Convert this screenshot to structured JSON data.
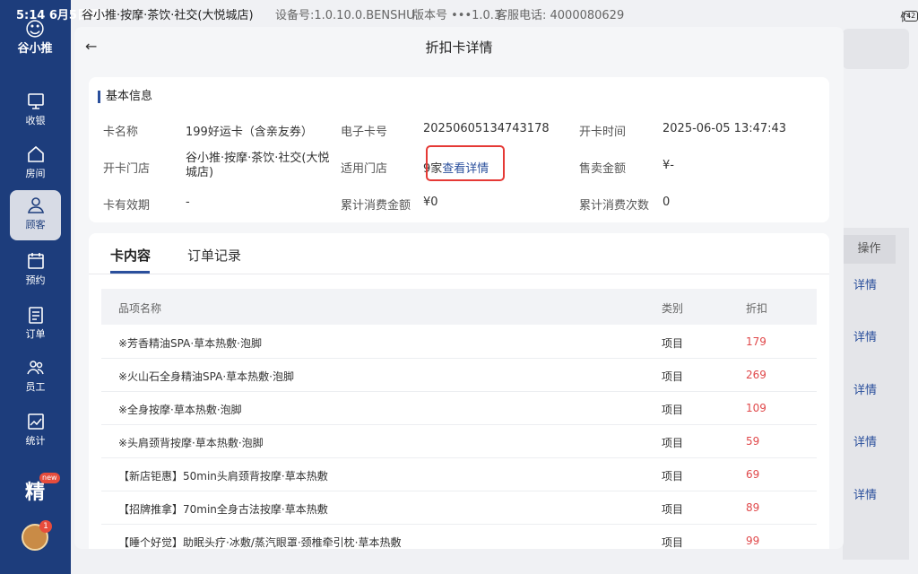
{
  "status_bar": {
    "time": "5:14  6月5日周四",
    "store": "谷小推·按摩·茶饮·社交(大悦城店)",
    "device": "设备号:1.0.10.0.BENSHU",
    "version": "版本号 •••1.0.3",
    "phone": "客服电话:  4000080629",
    "battery": "42"
  },
  "sidebar": {
    "logo_text": "谷小推",
    "items": [
      {
        "label": "收银",
        "icon": "cashier-icon"
      },
      {
        "label": "房间",
        "icon": "home-icon"
      },
      {
        "label": "顾客",
        "icon": "user-icon"
      },
      {
        "label": "预约",
        "icon": "calendar-icon"
      },
      {
        "label": "订单",
        "icon": "order-icon"
      },
      {
        "label": "员工",
        "icon": "staff-icon"
      },
      {
        "label": "统计",
        "icon": "chart-icon"
      }
    ],
    "active_index": 2,
    "promo_badge": "new",
    "promo_icon": "精",
    "avatar_badge": "1"
  },
  "background_page": {
    "column_header": "操作",
    "links": [
      "详情",
      "详情",
      "详情",
      "详情",
      "详情"
    ]
  },
  "modal": {
    "title": "折扣卡详情",
    "basic_info_title": "基本信息",
    "fields": {
      "card_name_label": "卡名称",
      "card_name": "199好运卡（含亲友券）",
      "card_no_label": "电子卡号",
      "card_no": "20250605134743178",
      "open_time_label": "开卡时间",
      "open_time": "2025-06-05 13:47:43",
      "open_store_label": "开卡门店",
      "open_store": "谷小推·按摩·茶饮·社交(大悦城店)",
      "applicable_store_label": "适用门店",
      "applicable_store_count": "9家",
      "view_detail": "查看详情",
      "sale_amount_label": "售卖金额",
      "sale_amount": "¥-",
      "validity_label": "卡有效期",
      "validity": "-",
      "total_spent_label": "累计消费金额",
      "total_spent": "¥0",
      "total_count_label": "累计消费次数",
      "total_count": "0"
    },
    "tabs": [
      {
        "label": "卡内容"
      },
      {
        "label": "订单记录"
      }
    ],
    "table": {
      "headers": [
        "品项名称",
        "类别",
        "折扣"
      ],
      "rows": [
        {
          "name": "※芳香精油SPA·草本热敷·泡脚",
          "type": "项目",
          "discount": "179"
        },
        {
          "name": "※火山石全身精油SPA·草本热敷·泡脚",
          "type": "项目",
          "discount": "269"
        },
        {
          "name": "※全身按摩·草本热敷·泡脚",
          "type": "项目",
          "discount": "109"
        },
        {
          "name": "※头肩颈背按摩·草本热敷·泡脚",
          "type": "项目",
          "discount": "59"
        },
        {
          "name": "【新店钜惠】50min头肩颈背按摩·草本热敷",
          "type": "项目",
          "discount": "69"
        },
        {
          "name": "【招牌推拿】70min全身古法按摩·草本热敷",
          "type": "项目",
          "discount": "89"
        },
        {
          "name": "【睡个好觉】助眠头疗·冰敷/蒸汽眼罩·颈椎牵引枕·草本热敷",
          "type": "项目",
          "discount": "99"
        }
      ]
    }
  }
}
